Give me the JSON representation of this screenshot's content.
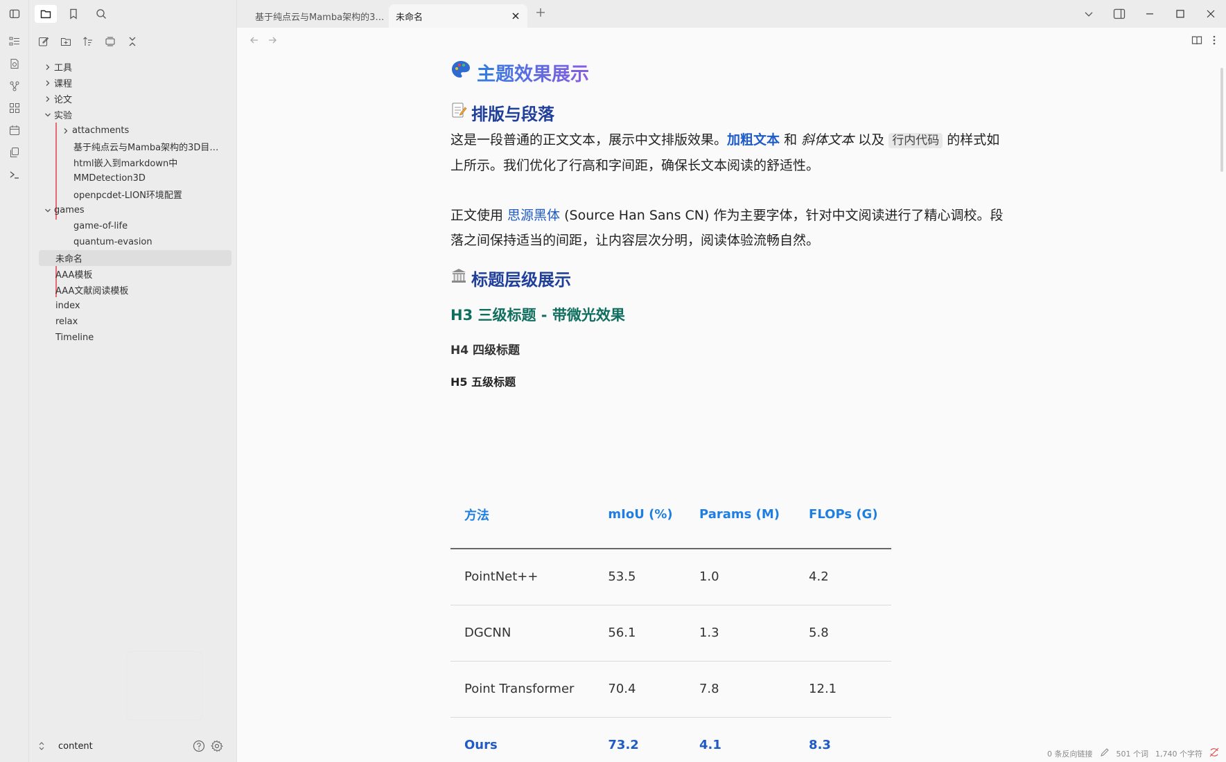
{
  "tabs": [
    {
      "label": "基于纯点云与Mamba架构的3…"
    },
    {
      "label": "未命名"
    }
  ],
  "sidebar": {
    "tree": [
      {
        "label": "工具"
      },
      {
        "label": "课程"
      },
      {
        "label": "论文"
      },
      {
        "label": "实验"
      },
      {
        "label": "attachments"
      },
      {
        "label": "基于纯点云与Mamba架构的3D目…"
      },
      {
        "label": "html嵌入到markdown中"
      },
      {
        "label": "MMDetection3D"
      },
      {
        "label": "openpcdet-LION环境配置"
      },
      {
        "label": "games"
      },
      {
        "label": "game-of-life"
      },
      {
        "label": "quantum-evasion"
      },
      {
        "label": "未命名"
      },
      {
        "label": "AAA模板"
      },
      {
        "label": "AAA文献阅读模板"
      },
      {
        "label": "index"
      },
      {
        "label": "relax"
      },
      {
        "label": "Timeline"
      }
    ],
    "vault_name": "content"
  },
  "doc": {
    "title": "主题效果展示",
    "sec1_title": "排版与段落",
    "p1_a": "这是一段普通的正文文本，展示中文排版效果。",
    "p1_bold": "加粗文本",
    "p1_b": " 和 ",
    "p1_ital": "斜体文本",
    "p1_c": " 以及 ",
    "p1_code": "行内代码",
    "p1_d": " 的样式如上所示。我们优化了行高和字间距，确保长文本阅读的舒适性。",
    "p2_a": "正文使用 ",
    "p2_link": "思源黑体",
    "p2_b": " (Source Han Sans CN) 作为主要字体，针对中文阅读进行了精心调校。段落之间保持适当的间距，让内容层次分明，阅读体验流畅自然。",
    "sec2_title": "标题层级展示",
    "h3": "H3 三级标题 - 带微光效果",
    "h4": "H4 四级标题",
    "h5": "H5 五级标题"
  },
  "table": {
    "headers": [
      "方法",
      "mIoU (%)",
      "Params (M)",
      "FLOPs (G)"
    ],
    "rows": [
      [
        "PointNet++",
        "53.5",
        "1.0",
        "4.2"
      ],
      [
        "DGCNN",
        "56.1",
        "1.3",
        "5.8"
      ],
      [
        "Point Transformer",
        "70.4",
        "7.8",
        "12.1"
      ],
      [
        "Ours",
        "73.2",
        "4.1",
        "8.3"
      ]
    ]
  },
  "status": {
    "backlinks": "0 条反向链接",
    "words": "501 个词",
    "chars": "1,740 个字符"
  }
}
